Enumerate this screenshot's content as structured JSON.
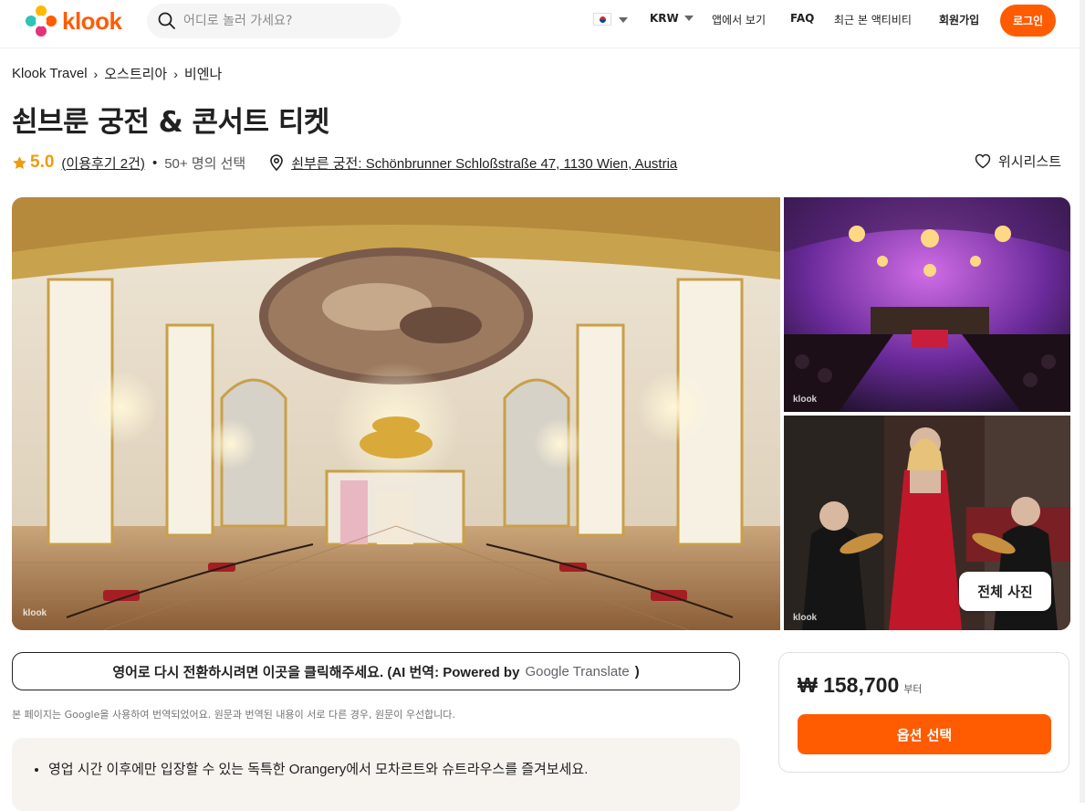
{
  "header": {
    "logo_text": "klook",
    "search_placeholder": "어디로 놀러 가세요?",
    "currency": "KRW",
    "nav_items": [
      "앱에서 보기",
      "FAQ",
      "최근 본 액티비티",
      "회원가입"
    ],
    "login_label": "로그인"
  },
  "breadcrumb": [
    "Klook Travel",
    "오스트리아",
    "비엔나"
  ],
  "title": "쇤브룬 궁전 & 콘서트 티켓",
  "meta": {
    "rating": "5.0",
    "reviews": "(이용후기 2건)",
    "booked": "50+ 명의 선택",
    "location": "쇤부른 궁전: Schönbrunner Schloßstraße 47, 1130 Wien, Austria",
    "wishlist": "위시리스트"
  },
  "gallery": {
    "watermark": "klook",
    "all_photos_label": "전체 사진"
  },
  "translate": {
    "button_text": "영어로 다시 전환하시려면 이곳을 클릭해주세요. (AI 번역: Powered by",
    "google_text": "Google Translate",
    "close_paren": ")",
    "note": "본 페이지는 Google을 사용하여 번역되었어요. 원문과 번역된 내용이 서로 다른 경우, 원문이 우선합니다."
  },
  "highlights": [
    "영업 시간 이후에만 입장할 수 있는 독특한 Orangery에서 모차르트와 슈트라우스를 즐겨보세요."
  ],
  "price": {
    "amount": "₩ 158,700",
    "suffix": "부터",
    "button_label": "옵션 선택"
  },
  "colors": {
    "brand": "#ff5b00",
    "rating": "#f09b0a"
  }
}
